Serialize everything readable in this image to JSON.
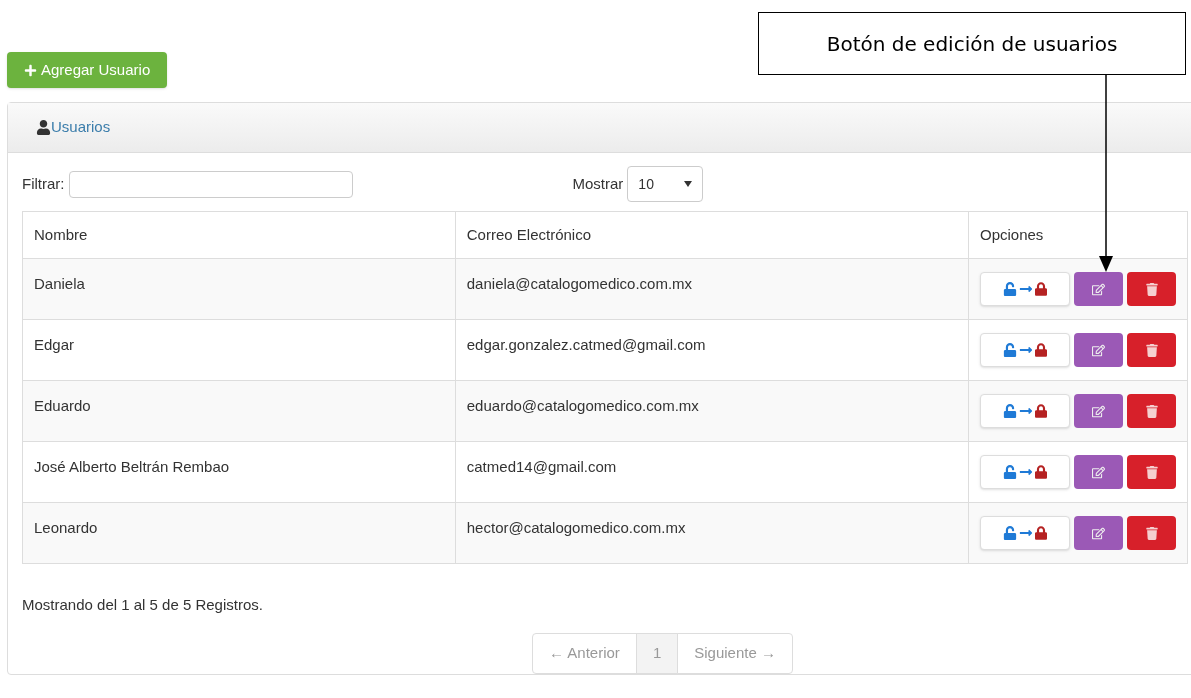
{
  "callout": {
    "text": "Botón de edición de usuarios"
  },
  "add_button": {
    "label": "Agregar Usuario"
  },
  "panel": {
    "title": "Usuarios"
  },
  "filter": {
    "label": "Filtrar:"
  },
  "show": {
    "label": "Mostrar",
    "value": "10"
  },
  "table": {
    "columns": [
      "Nombre",
      "Correo Electrónico",
      "Opciones"
    ],
    "rows": [
      {
        "name": "Daniela",
        "email": "daniela@catalogomedico.com.mx"
      },
      {
        "name": "Edgar",
        "email": "edgar.gonzalez.catmed@gmail.com"
      },
      {
        "name": "Eduardo",
        "email": "eduardo@catalogomedico.com.mx"
      },
      {
        "name": "José Alberto Beltrán Rembao",
        "email": "catmed14@gmail.com"
      },
      {
        "name": "Leonardo",
        "email": "hector@catalogomedico.com.mx"
      }
    ]
  },
  "summary": "Mostrando del 1 al 5 de 5 Registros.",
  "pagination": [
    {
      "label": "← Anterior",
      "selected": false
    },
    {
      "label": "1",
      "selected": true
    },
    {
      "label": "Siguiente →",
      "selected": false
    }
  ]
}
